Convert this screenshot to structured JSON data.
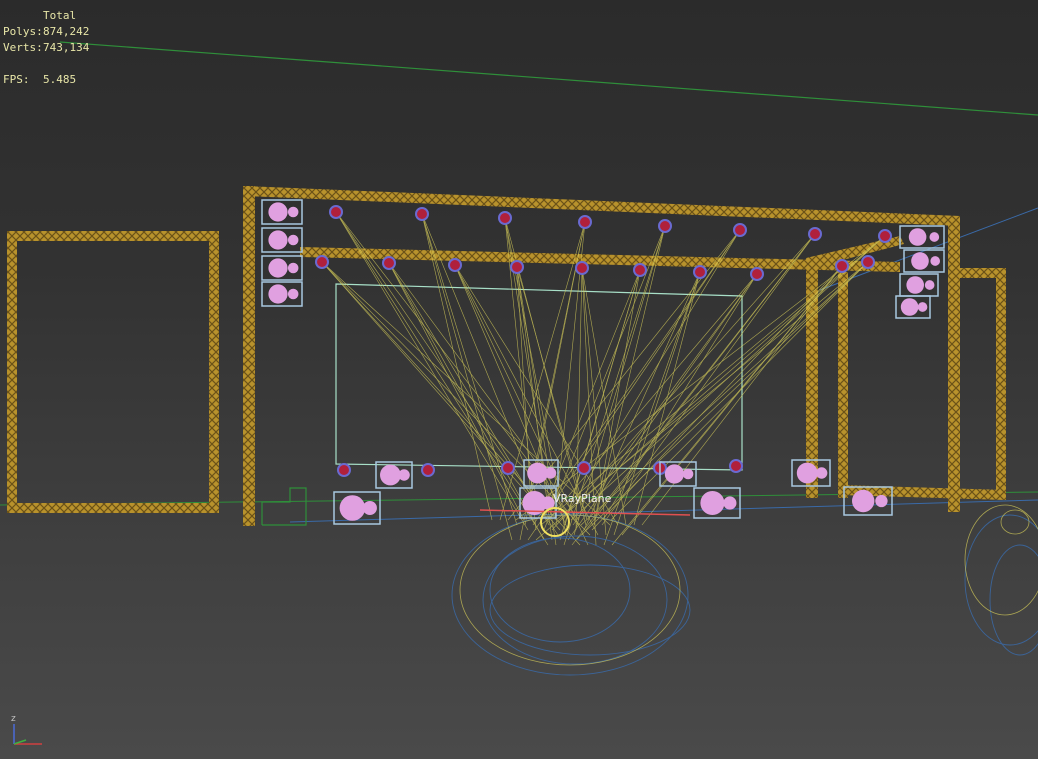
{
  "stats": {
    "header": "Total",
    "rows": [
      {
        "label": "Polys:",
        "value": "874,242"
      },
      {
        "label": "Verts:",
        "value": "743,134"
      },
      {
        "label": "FPS:",
        "value": "5.485"
      }
    ]
  },
  "object_label": "VRayPlane",
  "axis_gizmo": {
    "z_label": "z"
  },
  "colors": {
    "background": "#3c3c3c",
    "truss": "#c8a032",
    "spotlight_beam": "#d8cf5a",
    "speaker_box": "#a8c8e0",
    "speaker_cone": "#e0a0e0",
    "light_fixture": "#b0203c",
    "wire_blue": "#3a6aa8",
    "grid_green": "#2f8f3a"
  }
}
